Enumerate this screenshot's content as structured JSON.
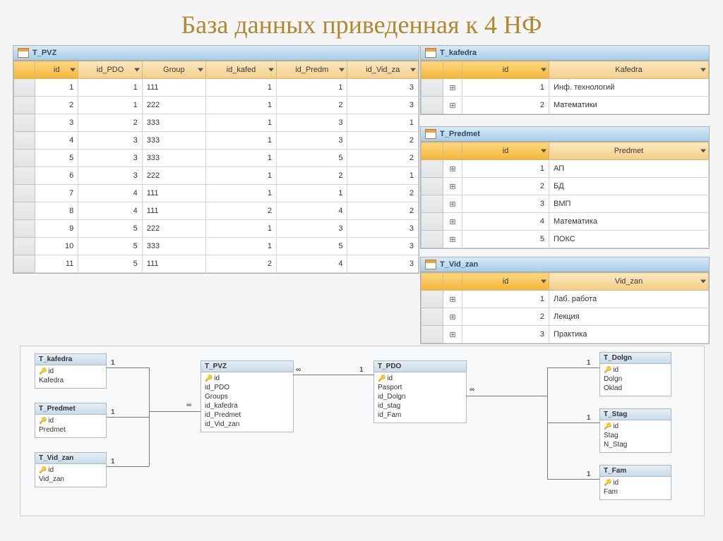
{
  "title": "База данных приведенная к 4 НФ",
  "tables": {
    "tpvz": {
      "tab": "T_PVZ",
      "cols": [
        "id",
        "id_PDO",
        "Group",
        "id_kafed",
        "id_Predm",
        "id_Vid_za"
      ],
      "rows": [
        [
          1,
          1,
          "111",
          1,
          1,
          3
        ],
        [
          2,
          1,
          "222",
          1,
          2,
          3
        ],
        [
          3,
          2,
          "333",
          1,
          3,
          1
        ],
        [
          4,
          3,
          "333",
          1,
          3,
          2
        ],
        [
          5,
          3,
          "333",
          1,
          5,
          2
        ],
        [
          6,
          3,
          "222",
          1,
          2,
          1
        ],
        [
          7,
          4,
          "111",
          1,
          1,
          2
        ],
        [
          8,
          4,
          "111",
          2,
          4,
          2
        ],
        [
          9,
          5,
          "222",
          1,
          3,
          3
        ],
        [
          10,
          5,
          "333",
          1,
          5,
          3
        ],
        [
          11,
          5,
          "111",
          2,
          4,
          3
        ]
      ]
    },
    "tkaf": {
      "tab": "T_kafedra",
      "cols": [
        "id",
        "Kafedra"
      ],
      "rows": [
        [
          1,
          "Инф. технологий"
        ],
        [
          2,
          "Математики"
        ]
      ]
    },
    "tpred": {
      "tab": "T_Predmet",
      "cols": [
        "id",
        "Predmet"
      ],
      "rows": [
        [
          1,
          "АП"
        ],
        [
          2,
          "БД"
        ],
        [
          3,
          "ВМП"
        ],
        [
          4,
          "Математика"
        ],
        [
          5,
          "ПОКС"
        ]
      ]
    },
    "tvid": {
      "tab": "T_Vid_zan",
      "cols": [
        "id",
        "Vid_zan"
      ],
      "rows": [
        [
          1,
          "Лаб. работа"
        ],
        [
          2,
          "Лекция"
        ],
        [
          3,
          "Практика"
        ]
      ]
    }
  },
  "rel": {
    "boxes": {
      "kaf": {
        "title": "T_kafedra",
        "fields": [
          "id",
          "Kafedra"
        ],
        "key": 0
      },
      "pred": {
        "title": "T_Predmet",
        "fields": [
          "id",
          "Predmet"
        ],
        "key": 0
      },
      "vid": {
        "title": "T_Vid_zan",
        "fields": [
          "id",
          "Vid_zan"
        ],
        "key": 0
      },
      "pvz": {
        "title": "T_PVZ",
        "fields": [
          "id",
          "id_PDO",
          "Groups",
          "id_kafedra",
          "id_Predmet",
          "id_Vid_zan"
        ],
        "key": 0
      },
      "pdo": {
        "title": "T_PDO",
        "fields": [
          "id",
          "Pasport",
          "id_Dolgn",
          "id_stag",
          "id_Fam"
        ],
        "key": 0
      },
      "dolgn": {
        "title": "T_Dolgn",
        "fields": [
          "id",
          "Dolgn",
          "Oklad"
        ],
        "key": 0
      },
      "stag": {
        "title": "T_Stag",
        "fields": [
          "id",
          "Stag",
          "N_Stag"
        ],
        "key": 0
      },
      "fam": {
        "title": "T_Fam",
        "fields": [
          "id",
          "Fam"
        ],
        "key": 0
      }
    },
    "labels": {
      "one": "1",
      "inf": "∞"
    }
  }
}
